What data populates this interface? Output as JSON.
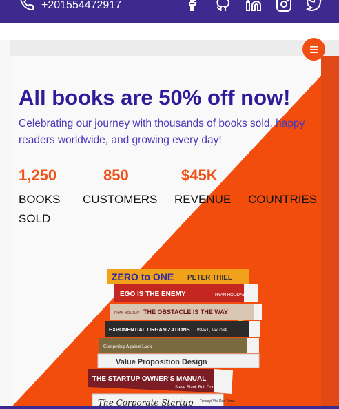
{
  "topbar": {
    "phone": "+201554472917",
    "socials": [
      "facebook-icon",
      "github-icon",
      "linkedin-icon",
      "instagram-icon",
      "twitter-icon"
    ]
  },
  "colors": {
    "brand": "#3d2a8f",
    "accent": "#f04e12",
    "title": "#2e1c9a"
  },
  "hero": {
    "title": "All books are 50% off now!",
    "subtitle": "Celebrating our journey with thousands of books sold, happy readers worldwide, and growing every day!",
    "stats": [
      {
        "value": "1,250",
        "label": "BOOKS SOLD"
      },
      {
        "value": "850",
        "label": "CUSTOMERS"
      },
      {
        "value": "$45K",
        "label": "REVENUE"
      },
      {
        "value": "",
        "label": "COUNTRIES"
      }
    ]
  },
  "books": [
    {
      "title": "ZERO to ONE",
      "author": "PETER THIEL"
    },
    {
      "title": "EGO IS THE ENEMY",
      "author": "RYAN HOLIDAY"
    },
    {
      "title": "THE OBSTACLE IS THE WAY",
      "author": "RYAN HOLIDAY"
    },
    {
      "title": "EXPONENTIAL ORGANIZATIONS",
      "author": "ISMAIL, MALONE"
    },
    {
      "title": "Competing Against Luck",
      "author": ""
    },
    {
      "title": "Value Proposition Design",
      "author": ""
    },
    {
      "title": "THE STARTUP OWNER'S MANUAL",
      "author": "Steve Blank Bob Dorf"
    },
    {
      "title": "The Corporate Startup",
      "author": "Tendayi Viki Dan Toma"
    }
  ]
}
